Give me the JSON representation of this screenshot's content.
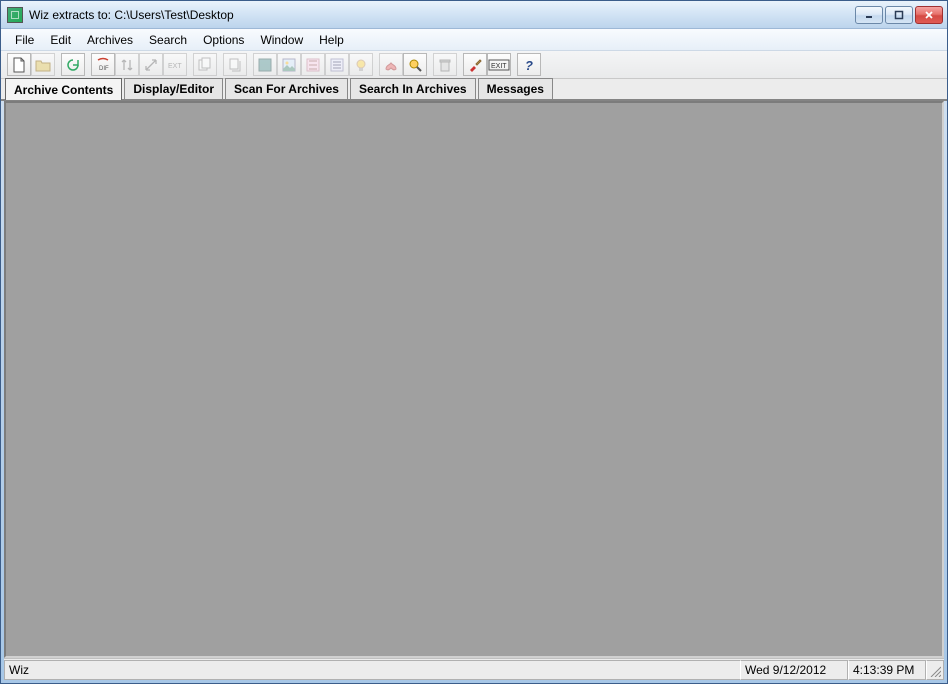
{
  "window": {
    "title": "Wiz extracts to: C:\\Users\\Test\\Desktop"
  },
  "menus": {
    "file": "File",
    "edit": "Edit",
    "archives": "Archives",
    "search": "Search",
    "options": "Options",
    "window": "Window",
    "help": "Help"
  },
  "toolbar": {
    "new": "new",
    "open": "open",
    "refresh": "refresh",
    "extract_dir": "dir",
    "extract_here1": "↓↑",
    "extract_here2": "✕✕",
    "extract_ext": "EXT",
    "add": "add",
    "copy": "copy",
    "view1": "v1",
    "view2": "v2",
    "view3": "v3",
    "view4": "v4",
    "bulb": "bulb",
    "fav": "fav",
    "search": "search",
    "delete": "del",
    "brush": "brush",
    "exit": "EXIT",
    "help": "?"
  },
  "tabs": {
    "archive_contents": "Archive Contents",
    "display_editor": "Display/Editor",
    "scan_for_archives": "Scan For Archives",
    "search_in_archives": "Search In Archives",
    "messages": "Messages"
  },
  "status": {
    "app": "Wiz",
    "date": "Wed 9/12/2012",
    "time": "4:13:39 PM"
  }
}
